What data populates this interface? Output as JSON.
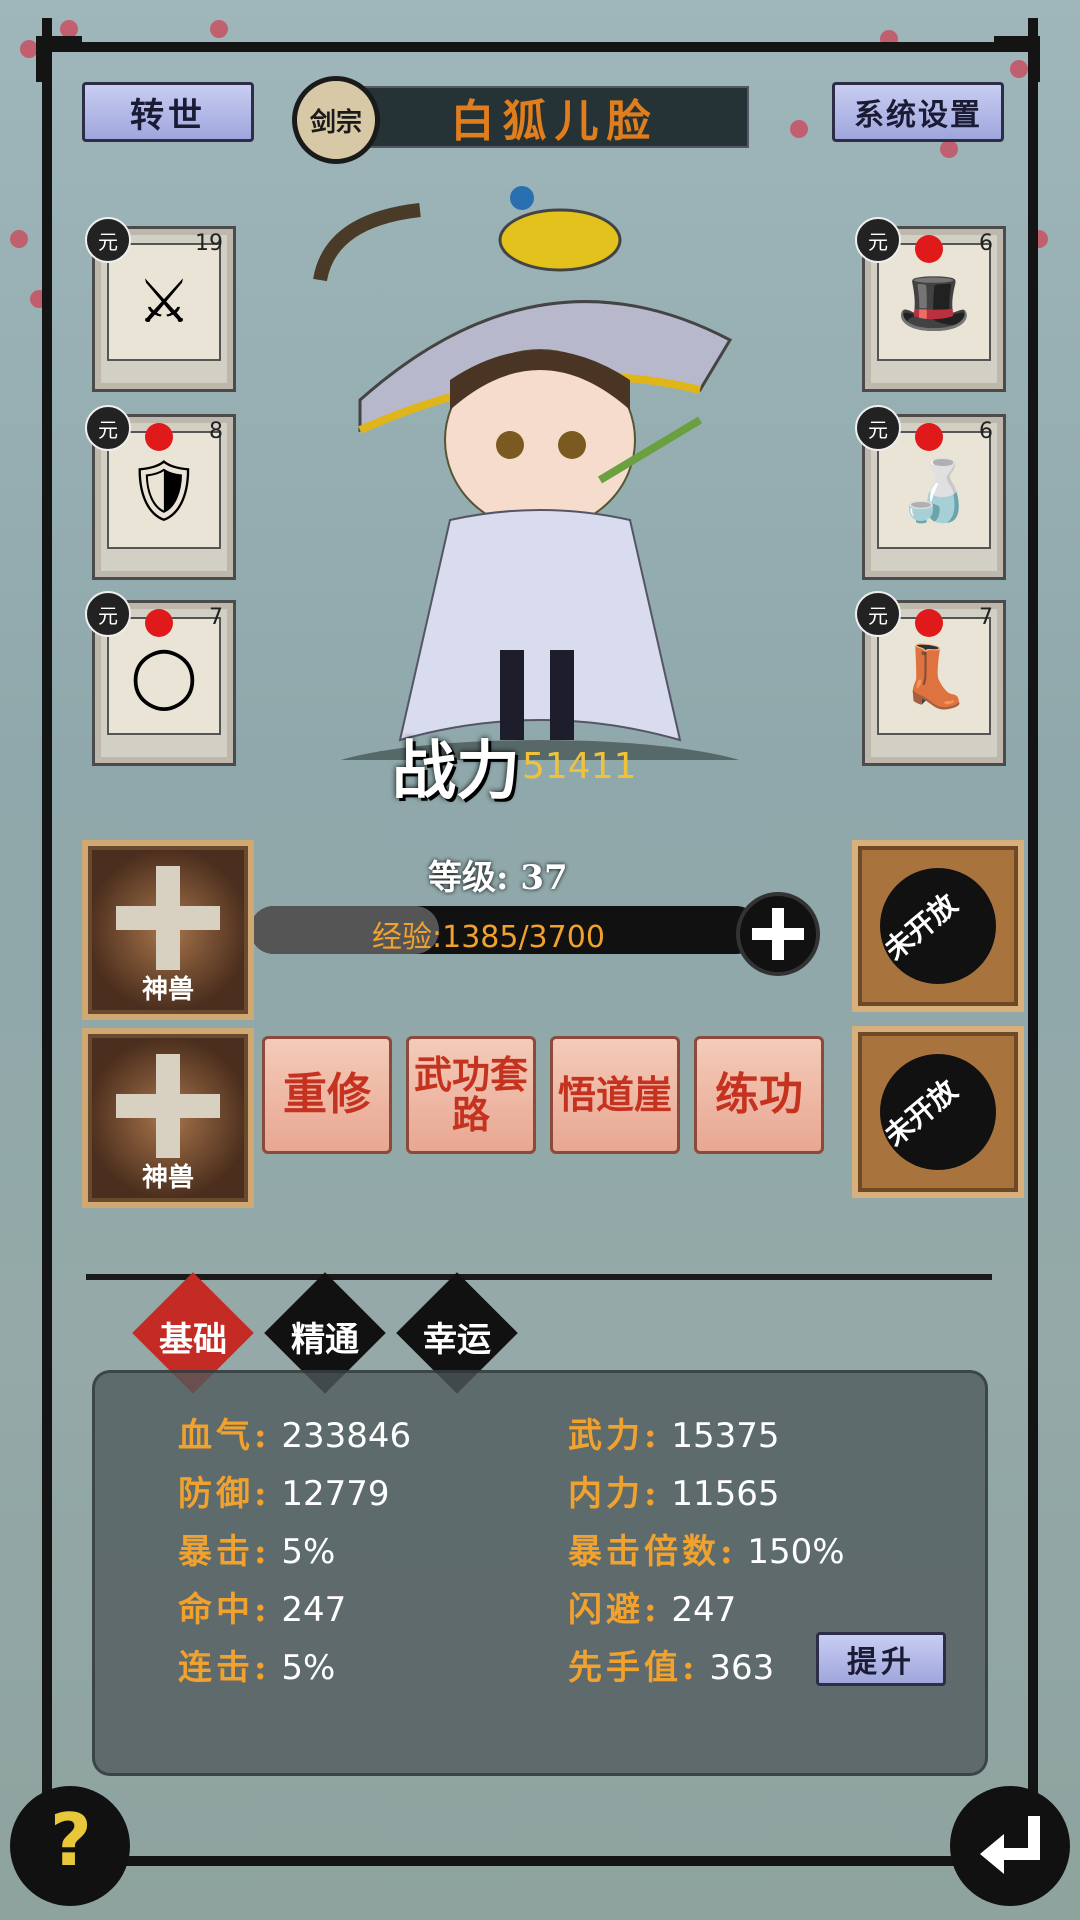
{
  "header": {
    "rebirth_label": "转世",
    "sect_label": "剑宗",
    "player_name": "白狐儿脸",
    "settings_label": "系统设置"
  },
  "equipment_left": [
    {
      "badge": "元",
      "count": "19",
      "icon": "sword-icon",
      "alert": false
    },
    {
      "badge": "元",
      "count": "8",
      "icon": "armor-icon",
      "alert": true
    },
    {
      "badge": "元",
      "count": "7",
      "icon": "ring-icon",
      "alert": true
    }
  ],
  "equipment_right": [
    {
      "badge": "元",
      "count": "6",
      "icon": "hat-icon",
      "alert": true
    },
    {
      "badge": "元",
      "count": "6",
      "icon": "gourd-icon",
      "alert": true
    },
    {
      "badge": "元",
      "count": "7",
      "icon": "boots-icon",
      "alert": true
    }
  ],
  "character": {
    "power_label": "战力",
    "power_value": "51411",
    "level_text": "等级: 37",
    "exp_text": "经验:1385/3700"
  },
  "beasts": [
    {
      "label": "神兽"
    },
    {
      "label": "神兽"
    }
  ],
  "locked_slots": [
    {
      "label": "未开放"
    },
    {
      "label": "未开放"
    }
  ],
  "functions": [
    {
      "label": "重修"
    },
    {
      "label": "武功套路"
    },
    {
      "label": "悟道崖"
    },
    {
      "label": "练功"
    }
  ],
  "tabs": [
    {
      "label": "基础",
      "active": true
    },
    {
      "label": "精通",
      "active": false
    },
    {
      "label": "幸运",
      "active": false
    }
  ],
  "stats": {
    "left": [
      {
        "key": "血气:",
        "value": "233846"
      },
      {
        "key": "防御:",
        "value": "12779"
      },
      {
        "key": "暴击:",
        "value": "5%"
      },
      {
        "key": "命中:",
        "value": "247"
      },
      {
        "key": "连击:",
        "value": "5%"
      }
    ],
    "right": [
      {
        "key": "武力:",
        "value": "15375"
      },
      {
        "key": "内力:",
        "value": "11565"
      },
      {
        "key": "暴击倍数:",
        "value": "150%"
      },
      {
        "key": "闪避:",
        "value": "247"
      },
      {
        "key": "先手值:",
        "value": "363"
      }
    ],
    "upgrade_label": "提升"
  },
  "footer": {
    "help_icon": "question-icon",
    "back_icon": "return-arrow-icon",
    "help_text": "?"
  },
  "colors": {
    "accent_orange": "#f0a12e",
    "name_orange": "#e07d1c",
    "active_tab": "#c42b25",
    "alert_dot": "#e01a1a"
  }
}
